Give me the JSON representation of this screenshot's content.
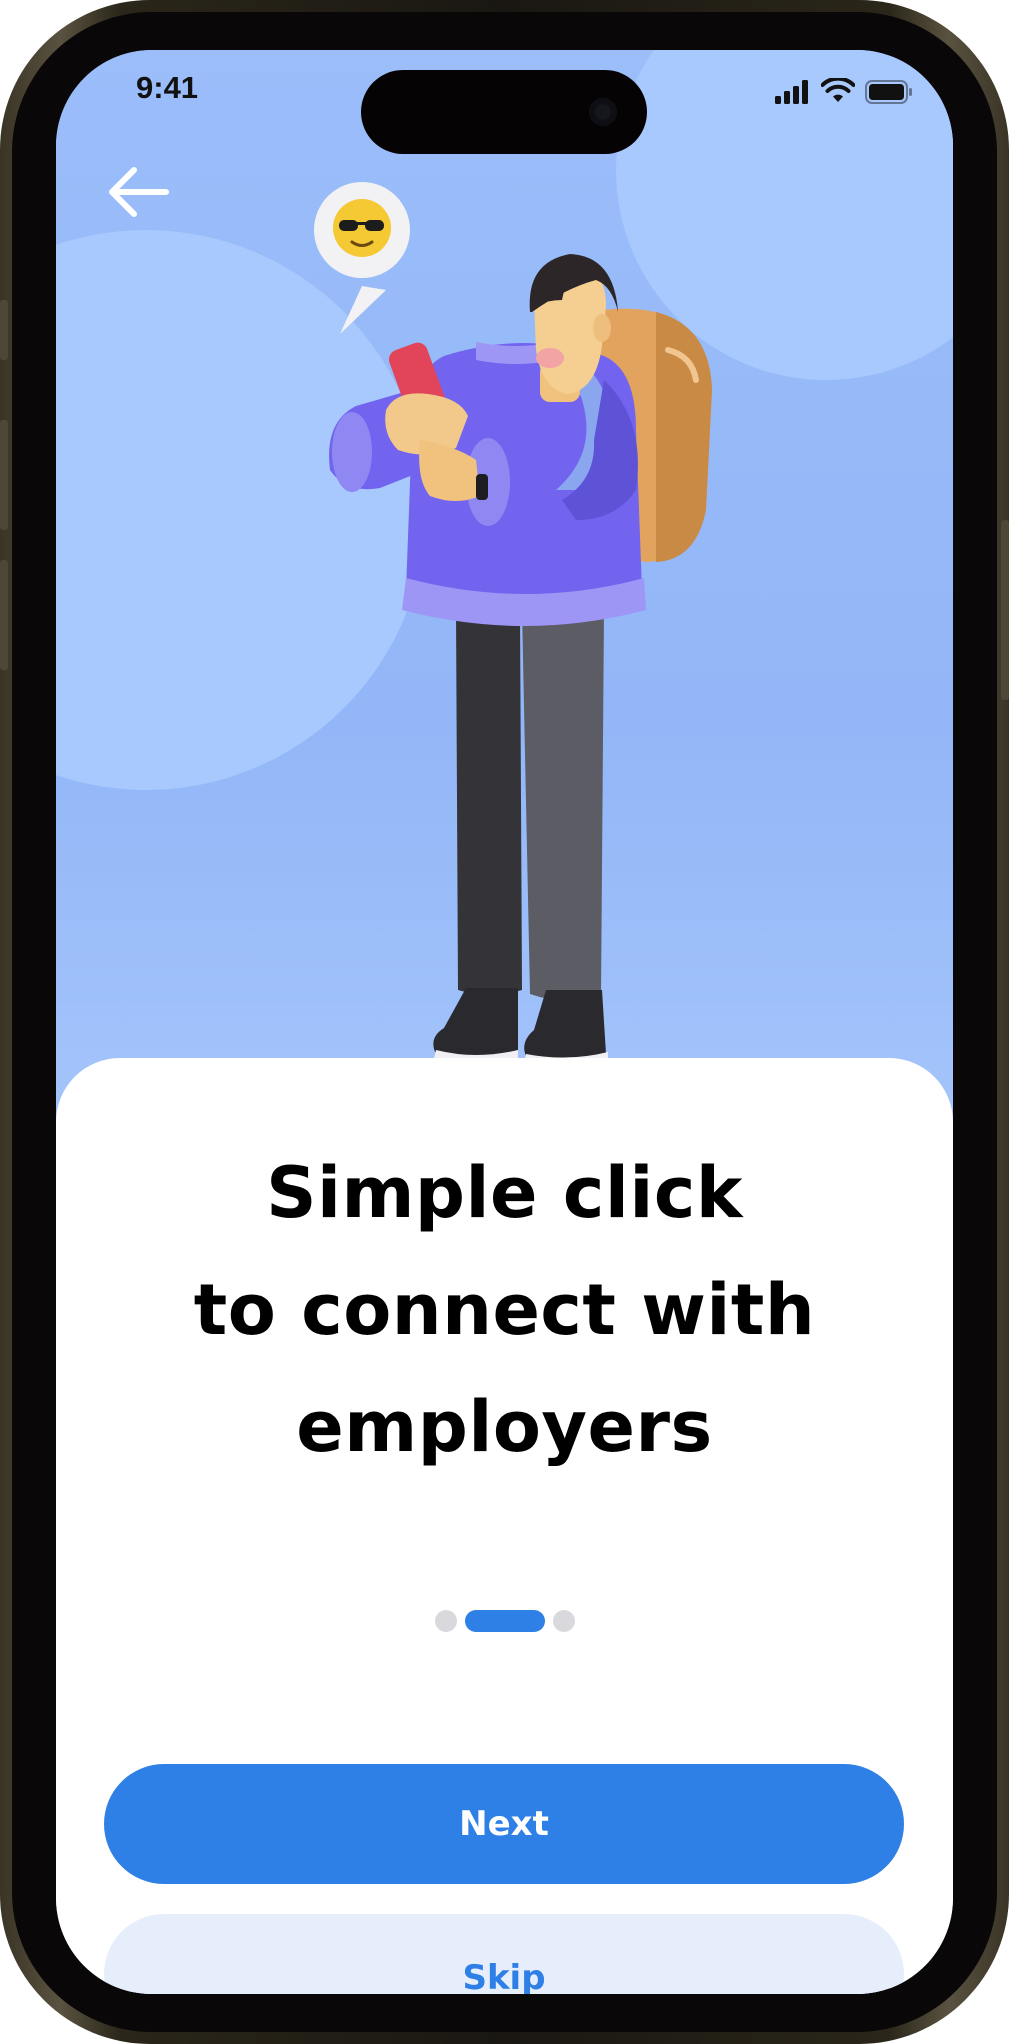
{
  "status_bar": {
    "time": "9:41",
    "icons": [
      "cellular-signal-icon",
      "wifi-icon",
      "battery-icon"
    ]
  },
  "navigation": {
    "back_icon": "arrow-left-icon"
  },
  "onboarding": {
    "headline": "Simple click\n to connect with\nemployers",
    "page_indicator": {
      "total": 3,
      "current": 2
    }
  },
  "actions": {
    "next_label": "Next",
    "skip_label": "Skip"
  },
  "colors": {
    "accent": "#2F80E6",
    "hero_background": "#92B6F7",
    "skip_background": "#E6EEFB",
    "dot_inactive": "#D9D9DD"
  }
}
